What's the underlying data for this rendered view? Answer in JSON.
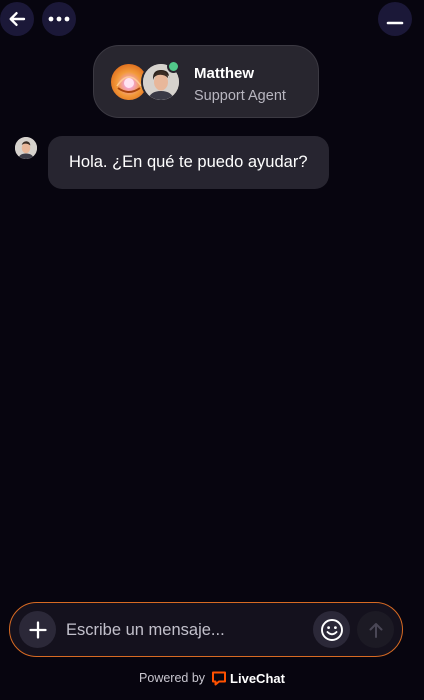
{
  "header": {
    "back_icon": "arrow-left-icon",
    "more_icon": "more-horizontal-icon",
    "minimize_icon": "minimize-icon"
  },
  "agent": {
    "name": "Matthew",
    "role": "Support Agent",
    "status": "online",
    "status_color": "#52c98a"
  },
  "messages": [
    {
      "from": "agent",
      "text": "Hola. ¿En qué te puedo ayudar?"
    }
  ],
  "composer": {
    "placeholder": "Escribe un mensaje...",
    "value": "",
    "accent_color": "#d76a23",
    "add_icon": "plus-icon",
    "emoji_icon": "smiley-icon",
    "send_icon": "arrow-up-icon"
  },
  "footer": {
    "powered_by": "Powered by",
    "brand": "LiveChat",
    "brand_color": "#ff5100"
  },
  "colors": {
    "background": "#07050f",
    "bubble": "#272530",
    "header_button": "#1b1838"
  }
}
